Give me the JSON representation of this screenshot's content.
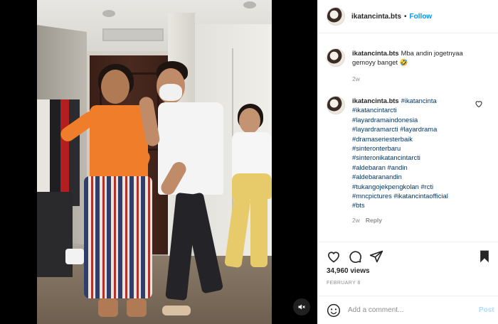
{
  "post": {
    "username": "ikatancinta.bts",
    "follow_label": "Follow",
    "separator": "•"
  },
  "comments": [
    {
      "user": "ikatancinta.bts",
      "text": "Mba andin jogetnyaa gemoyy banget",
      "emoji": "🤣",
      "time": "2w"
    },
    {
      "user": "ikatancinta.bts",
      "first_tag": "#ikatancinta",
      "tags": [
        "#ikatancintarcti",
        "#layardramaindonesia",
        "#layardramarcti #layardrama",
        "#dramaseriesterbaik",
        "#sinteronterbaru",
        "#sinteronikatancintarcti",
        "#aldebaran #andin",
        "#aldebaranandin",
        "#tukangojekpengkolan #rcti",
        "#mncpictures #ikatancintaofficial",
        "#bts"
      ],
      "time": "2w",
      "reply_label": "Reply"
    }
  ],
  "stats": {
    "views": "34,960 views",
    "date": "FEBRUARY 8"
  },
  "add_comment": {
    "placeholder": "Add a comment...",
    "post_label": "Post"
  },
  "icons": {
    "like": "heart-icon",
    "comment": "comment-icon",
    "share": "share-icon",
    "save": "bookmark-icon",
    "emoji": "smiley-icon",
    "mute": "speaker-muted-icon"
  },
  "colors": {
    "link_blue": "#0095f6",
    "hashtag": "#00376b",
    "post_disabled": "#b3dbff",
    "muted_text": "#8e8e8e"
  }
}
